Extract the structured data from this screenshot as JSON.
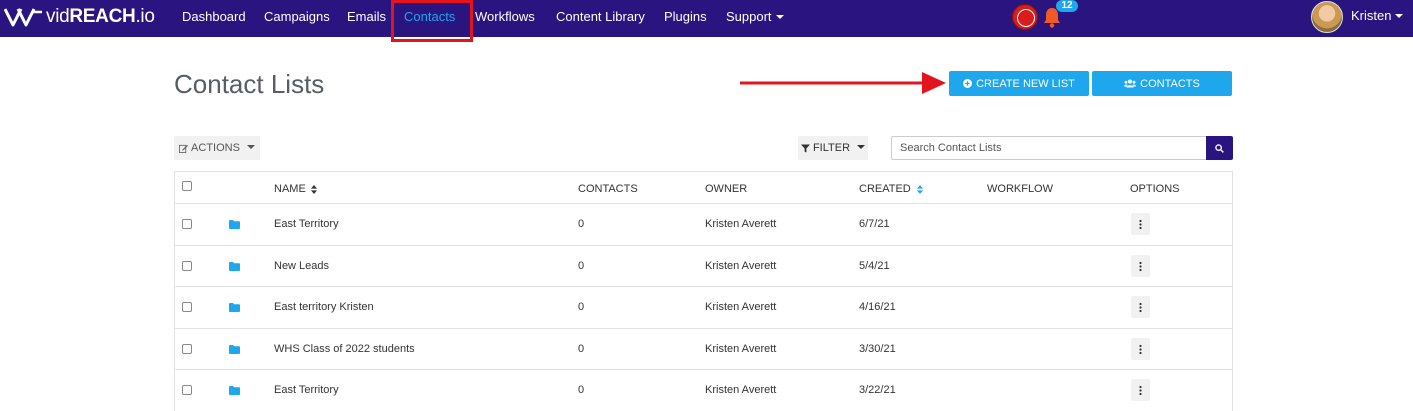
{
  "app": {
    "logo_prefix": "vid",
    "logo_bold": "REACH",
    "logo_suffix": ".io"
  },
  "nav": {
    "items": [
      "Dashboard",
      "Campaigns",
      "Emails",
      "Contacts",
      "Workflows",
      "Content Library",
      "Plugins",
      "Support"
    ],
    "active": "Contacts",
    "notification_count": "12",
    "user_name": "Kristen"
  },
  "page": {
    "title": "Contact Lists",
    "create_button": "CREATE NEW LIST",
    "contacts_button": "CONTACTS",
    "actions_button": "ACTIONS",
    "filter_button": "FILTER",
    "search_placeholder": "Search Contact Lists"
  },
  "table": {
    "columns": [
      "NAME",
      "CONTACTS",
      "OWNER",
      "CREATED",
      "WORKFLOW",
      "OPTIONS"
    ],
    "rows": [
      {
        "name": "East Territory",
        "contacts": "0",
        "owner": "Kristen Averett",
        "created": "6/7/21",
        "workflow": ""
      },
      {
        "name": "New Leads",
        "contacts": "0",
        "owner": "Kristen Averett",
        "created": "5/4/21",
        "workflow": ""
      },
      {
        "name": "East territory Kristen",
        "contacts": "0",
        "owner": "Kristen Averett",
        "created": "4/16/21",
        "workflow": ""
      },
      {
        "name": "WHS Class of 2022 students",
        "contacts": "0",
        "owner": "Kristen Averett",
        "created": "3/30/21",
        "workflow": ""
      },
      {
        "name": "East Territory",
        "contacts": "0",
        "owner": "Kristen Averett",
        "created": "3/22/21",
        "workflow": ""
      }
    ]
  },
  "icons": {
    "logo": "vidreach-logo-icon",
    "record": "record-icon",
    "bell": "bell-icon",
    "create": "plus-circle-icon",
    "contacts": "users-icon",
    "actions": "edit-icon",
    "filter": "filter-icon",
    "search": "search-icon",
    "folder": "folder-icon",
    "options": "kebab-menu-icon",
    "sort": "sort-icon",
    "annotation_arrow": "arrow-right-icon"
  },
  "colors": {
    "navbar": "#2a1580",
    "accent": "#1ea7ec",
    "highlight": "#e3141b",
    "notification": "#f05a28"
  }
}
